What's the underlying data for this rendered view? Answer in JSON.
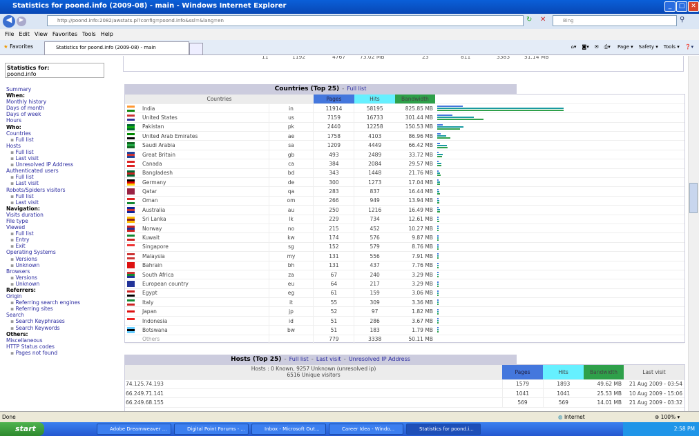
{
  "window": {
    "title": "Statistics for poond.info (2009-08) - main - Windows Internet Explorer"
  },
  "address": {
    "url": "http://poond.info:2082/awstats.pl?config=poond.info&ssl=&lang=en",
    "search_placeholder": "Bing"
  },
  "menu": [
    "File",
    "Edit",
    "View",
    "Favorites",
    "Tools",
    "Help"
  ],
  "favorites": {
    "label": "Favorites",
    "tab": "Statistics for poond.info (2009-08) - main"
  },
  "toolbar": {
    "page": "Page ▾",
    "safety": "Safety ▾",
    "tools": "Tools ▾"
  },
  "top_row": [
    "11",
    "1192",
    "4767",
    "73.02 MB",
    "23",
    "811",
    "3383",
    "51.14 MB"
  ],
  "sidebar": {
    "stats_for": "Statistics for:",
    "site": "poond.info",
    "items": [
      {
        "t": "link",
        "l": "Summary"
      },
      {
        "t": "head",
        "l": "When:"
      },
      {
        "t": "link",
        "l": "Monthly history"
      },
      {
        "t": "link",
        "l": "Days of month"
      },
      {
        "t": "link",
        "l": "Days of week"
      },
      {
        "t": "link",
        "l": "Hours"
      },
      {
        "t": "head",
        "l": "Who:"
      },
      {
        "t": "link",
        "l": "Countries"
      },
      {
        "t": "sub",
        "l": "Full list"
      },
      {
        "t": "link",
        "l": "Hosts"
      },
      {
        "t": "sub",
        "l": "Full list"
      },
      {
        "t": "sub",
        "l": "Last visit"
      },
      {
        "t": "sub",
        "l": "Unresolved IP Address"
      },
      {
        "t": "link",
        "l": "Authenticated users"
      },
      {
        "t": "sub",
        "l": "Full list"
      },
      {
        "t": "sub",
        "l": "Last visit"
      },
      {
        "t": "link",
        "l": "Robots/Spiders visitors"
      },
      {
        "t": "sub",
        "l": "Full list"
      },
      {
        "t": "sub",
        "l": "Last visit"
      },
      {
        "t": "head",
        "l": "Navigation:"
      },
      {
        "t": "link",
        "l": "Visits duration"
      },
      {
        "t": "link",
        "l": "File type"
      },
      {
        "t": "link",
        "l": "Viewed"
      },
      {
        "t": "sub",
        "l": "Full list"
      },
      {
        "t": "sub",
        "l": "Entry"
      },
      {
        "t": "sub",
        "l": "Exit"
      },
      {
        "t": "link",
        "l": "Operating Systems"
      },
      {
        "t": "sub",
        "l": "Versions"
      },
      {
        "t": "sub",
        "l": "Unknown"
      },
      {
        "t": "link",
        "l": "Browsers"
      },
      {
        "t": "sub",
        "l": "Versions"
      },
      {
        "t": "sub",
        "l": "Unknown"
      },
      {
        "t": "head",
        "l": "Referrers:"
      },
      {
        "t": "link",
        "l": "Origin"
      },
      {
        "t": "sub",
        "l": "Referring search engines"
      },
      {
        "t": "sub",
        "l": "Referring sites"
      },
      {
        "t": "link",
        "l": "Search"
      },
      {
        "t": "sub",
        "l": "Search Keyphrases"
      },
      {
        "t": "sub",
        "l": "Search Keywords"
      },
      {
        "t": "head",
        "l": "Others:"
      },
      {
        "t": "link",
        "l": "Miscellaneous"
      },
      {
        "t": "link",
        "l": "HTTP Status codes"
      },
      {
        "t": "sub",
        "l": "Pages not found"
      }
    ]
  },
  "countries": {
    "title": "Countries (Top 25)",
    "full_list": "Full list",
    "headers": {
      "countries": "Countries",
      "pages": "Pages",
      "hits": "Hits",
      "bandwidth": "Bandwidth"
    },
    "colors": {
      "pages": "#4477dd",
      "hits": "#66f0ff",
      "bandwidth": "#2ea04a"
    },
    "rows": [
      {
        "name": "India",
        "code": "in",
        "pages": 11914,
        "hits": 58195,
        "bw": "825.85 MB",
        "bwmb": 825.85,
        "flag": [
          "#f93",
          "#fff",
          "#181"
        ]
      },
      {
        "name": "United States",
        "code": "us",
        "pages": 7159,
        "hits": 16733,
        "bw": "301.44 MB",
        "bwmb": 301.44,
        "flag": [
          "#c33",
          "#fff",
          "#339"
        ]
      },
      {
        "name": "Pakistan",
        "code": "pk",
        "pages": 2440,
        "hits": 12258,
        "bw": "150.53 MB",
        "bwmb": 150.53,
        "flag": [
          "#063",
          "#1a1",
          "#063"
        ]
      },
      {
        "name": "United Arab Emirates",
        "code": "ae",
        "pages": 1758,
        "hits": 4103,
        "bw": "86.96 MB",
        "bwmb": 86.96,
        "flag": [
          "#080",
          "#fff",
          "#000"
        ]
      },
      {
        "name": "Saudi Arabia",
        "code": "sa",
        "pages": 1209,
        "hits": 4449,
        "bw": "66.42 MB",
        "bwmb": 66.42,
        "flag": [
          "#162",
          "#2a4",
          "#162"
        ]
      },
      {
        "name": "Great Britain",
        "code": "gb",
        "pages": 493,
        "hits": 2489,
        "bw": "33.72 MB",
        "bwmb": 33.72,
        "flag": [
          "#249",
          "#c33",
          "#249"
        ]
      },
      {
        "name": "Canada",
        "code": "ca",
        "pages": 384,
        "hits": 2084,
        "bw": "29.57 MB",
        "bwmb": 29.57,
        "flag": [
          "#d22",
          "#fff",
          "#d22"
        ]
      },
      {
        "name": "Bangladesh",
        "code": "bd",
        "pages": 343,
        "hits": 1448,
        "bw": "21.76 MB",
        "bwmb": 21.76,
        "flag": [
          "#063",
          "#c22",
          "#063"
        ]
      },
      {
        "name": "Germany",
        "code": "de",
        "pages": 300,
        "hits": 1273,
        "bw": "17.04 MB",
        "bwmb": 17.04,
        "flag": [
          "#000",
          "#d00",
          "#fc0"
        ]
      },
      {
        "name": "Qatar",
        "code": "qa",
        "pages": 283,
        "hits": 837,
        "bw": "16.44 MB",
        "bwmb": 16.44,
        "flag": [
          "#924",
          "#924",
          "#924"
        ]
      },
      {
        "name": "Oman",
        "code": "om",
        "pages": 266,
        "hits": 949,
        "bw": "13.94 MB",
        "bwmb": 13.94,
        "flag": [
          "#d22",
          "#fff",
          "#183"
        ]
      },
      {
        "name": "Australia",
        "code": "au",
        "pages": 250,
        "hits": 1216,
        "bw": "16.49 MB",
        "bwmb": 16.49,
        "flag": [
          "#129",
          "#c33",
          "#129"
        ]
      },
      {
        "name": "Sri Lanka",
        "code": "lk",
        "pages": 229,
        "hits": 734,
        "bw": "12.61 MB",
        "bwmb": 12.61,
        "flag": [
          "#fb0",
          "#822",
          "#fb0"
        ]
      },
      {
        "name": "Norway",
        "code": "no",
        "pages": 215,
        "hits": 452,
        "bw": "10.27 MB",
        "bwmb": 10.27,
        "flag": [
          "#c22",
          "#239",
          "#c22"
        ]
      },
      {
        "name": "Kuwait",
        "code": "kw",
        "pages": 174,
        "hits": 576,
        "bw": "9.87 MB",
        "bwmb": 9.87,
        "flag": [
          "#183",
          "#fff",
          "#c22"
        ]
      },
      {
        "name": "Singapore",
        "code": "sg",
        "pages": 152,
        "hits": 579,
        "bw": "8.76 MB",
        "bwmb": 8.76,
        "flag": [
          "#e33",
          "#fff",
          "#fff"
        ]
      },
      {
        "name": "Malaysia",
        "code": "my",
        "pages": 131,
        "hits": 556,
        "bw": "7.91 MB",
        "bwmb": 7.91,
        "flag": [
          "#c33",
          "#fff",
          "#c33"
        ]
      },
      {
        "name": "Bahrain",
        "code": "bh",
        "pages": 131,
        "hits": 437,
        "bw": "7.76 MB",
        "bwmb": 7.76,
        "flag": [
          "#d11",
          "#d11",
          "#d11"
        ]
      },
      {
        "name": "South Africa",
        "code": "za",
        "pages": 67,
        "hits": 240,
        "bw": "3.29 MB",
        "bwmb": 3.29,
        "flag": [
          "#c33",
          "#183",
          "#239"
        ]
      },
      {
        "name": "European country",
        "code": "eu",
        "pages": 64,
        "hits": 217,
        "bw": "3.29 MB",
        "bwmb": 3.29,
        "flag": [
          "#239",
          "#239",
          "#239"
        ]
      },
      {
        "name": "Egypt",
        "code": "eg",
        "pages": 61,
        "hits": 159,
        "bw": "3.06 MB",
        "bwmb": 3.06,
        "flag": [
          "#c22",
          "#fff",
          "#000"
        ]
      },
      {
        "name": "Italy",
        "code": "it",
        "pages": 55,
        "hits": 309,
        "bw": "3.36 MB",
        "bwmb": 3.36,
        "flag": [
          "#183",
          "#fff",
          "#c22"
        ]
      },
      {
        "name": "Japan",
        "code": "jp",
        "pages": 52,
        "hits": 97,
        "bw": "1.82 MB",
        "bwmb": 1.82,
        "flag": [
          "#fff",
          "#d11",
          "#fff"
        ]
      },
      {
        "name": "Indonesia",
        "code": "id",
        "pages": 51,
        "hits": 286,
        "bw": "3.67 MB",
        "bwmb": 3.67,
        "flag": [
          "#e22",
          "#fff",
          "#fff"
        ]
      },
      {
        "name": "Botswana",
        "code": "bw",
        "pages": 51,
        "hits": 183,
        "bw": "1.79 MB",
        "bwmb": 1.79,
        "flag": [
          "#6cf",
          "#000",
          "#6cf"
        ]
      }
    ],
    "others": {
      "name": "Others",
      "pages": "779",
      "hits": "3338",
      "bw": "50.11 MB"
    }
  },
  "hosts": {
    "title": "Hosts (Top 25)",
    "links": [
      "Full list",
      "Last visit",
      "Unresolved IP Address"
    ],
    "summary1": "Hosts : 0 Known, 9257 Unknown (unresolved ip)",
    "summary2": "6516 Unique visitors",
    "headers": {
      "pages": "Pages",
      "hits": "Hits",
      "bandwidth": "Bandwidth",
      "last": "Last visit"
    },
    "rows": [
      {
        "host": "74.125.74.193",
        "pages": "1579",
        "hits": "1893",
        "bw": "49.62 MB",
        "last": "21 Aug 2009 - 03:54"
      },
      {
        "host": "66.249.71.141",
        "pages": "1041",
        "hits": "1041",
        "bw": "25.53 MB",
        "last": "10 Aug 2009 - 15:06"
      },
      {
        "host": "66.249.68.155",
        "pages": "569",
        "hits": "569",
        "bw": "14.01 MB",
        "last": "21 Aug 2009 - 03:32"
      }
    ]
  },
  "status": {
    "left": "Done",
    "zone": "Internet",
    "zoom": "100%"
  },
  "taskbar": {
    "start": "start",
    "tasks": [
      "Adobe Dreamweaver ...",
      "Digital Point Forums - ...",
      "Inbox - Microsoft Out...",
      "Career Idea - Windo...",
      "Statistics for poond.i..."
    ],
    "time": "2:58 PM"
  }
}
